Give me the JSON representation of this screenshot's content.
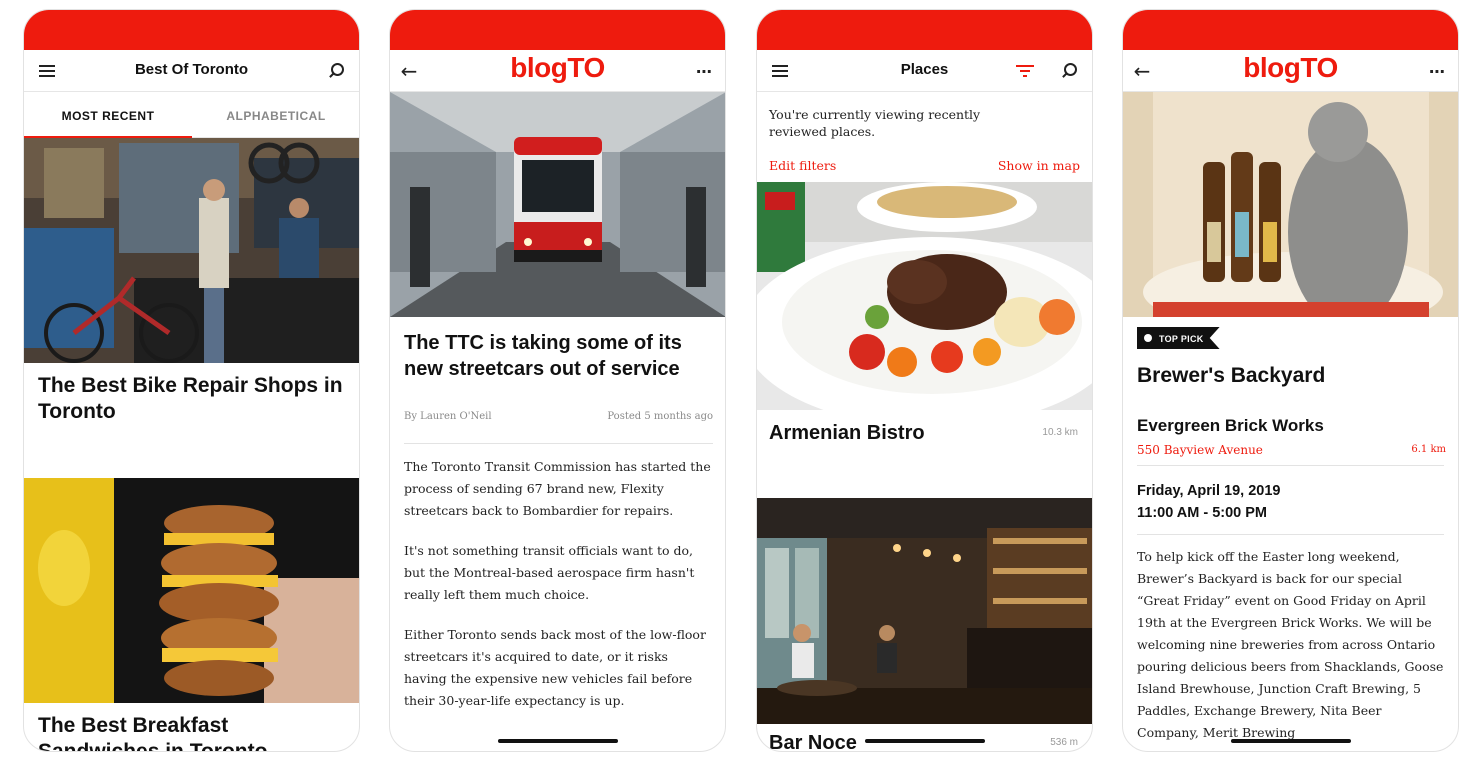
{
  "screen1": {
    "nav_title": "Best Of Toronto",
    "tabs": [
      {
        "label": "MOST RECENT",
        "active": true
      },
      {
        "label": "ALPHABETICAL",
        "active": false
      }
    ],
    "articles": [
      {
        "title": "The Best Bike Repair Shops in Toronto"
      },
      {
        "title": "The Best Breakfast Sandwiches in Toronto"
      }
    ]
  },
  "screen2": {
    "logo": "blogTO",
    "title": "The TTC is taking some of its new streetcars out of service",
    "byline": "By Lauren O'Neil",
    "posted": "Posted 5 months ago",
    "paragraphs": [
      "The Toronto Transit Commission has started the process of sending 67 brand new, Flexity streetcars back to Bombardier for repairs.",
      "It's not something transit officials want to do, but the Montreal-based aerospace firm hasn't really left them much choice.",
      "Either Toronto sends back most of the low-floor streetcars it's acquired to date, or it risks having the expensive new vehicles fail before their 30-year-life expectancy is up."
    ]
  },
  "screen3": {
    "nav_title": "Places",
    "notice": "You're currently viewing recently reviewed places.",
    "edit_filters": "Edit filters",
    "show_in_map": "Show in map",
    "places": [
      {
        "name": "Armenian Bistro",
        "distance": "10.3 km"
      },
      {
        "name": "Bar Noce",
        "distance": "536 m"
      }
    ]
  },
  "screen4": {
    "logo": "blogTO",
    "badge": "TOP PICK",
    "event_title": "Brewer's Backyard",
    "venue": "Evergreen Brick Works",
    "address": "550 Bayview Avenue",
    "distance": "6.1 km",
    "date": "Friday, April 19, 2019",
    "time": "11:00 AM - 5:00 PM",
    "description": "To help kick off the Easter long weekend, Brewer’s Backyard is back for our special “Great Friday” event on Good Friday on April 19th at the Evergreen Brick Works. We will be welcoming nine breweries from across Ontario pouring delicious beers from Shacklands, Goose Island Brewhouse, Junction Craft Brewing, 5 Paddles, Exchange Brewery, Nita Beer Company, Merit Brewing"
  },
  "colors": {
    "brand_red": "#ee1b0e",
    "text": "#111111",
    "muted": "#888888"
  }
}
